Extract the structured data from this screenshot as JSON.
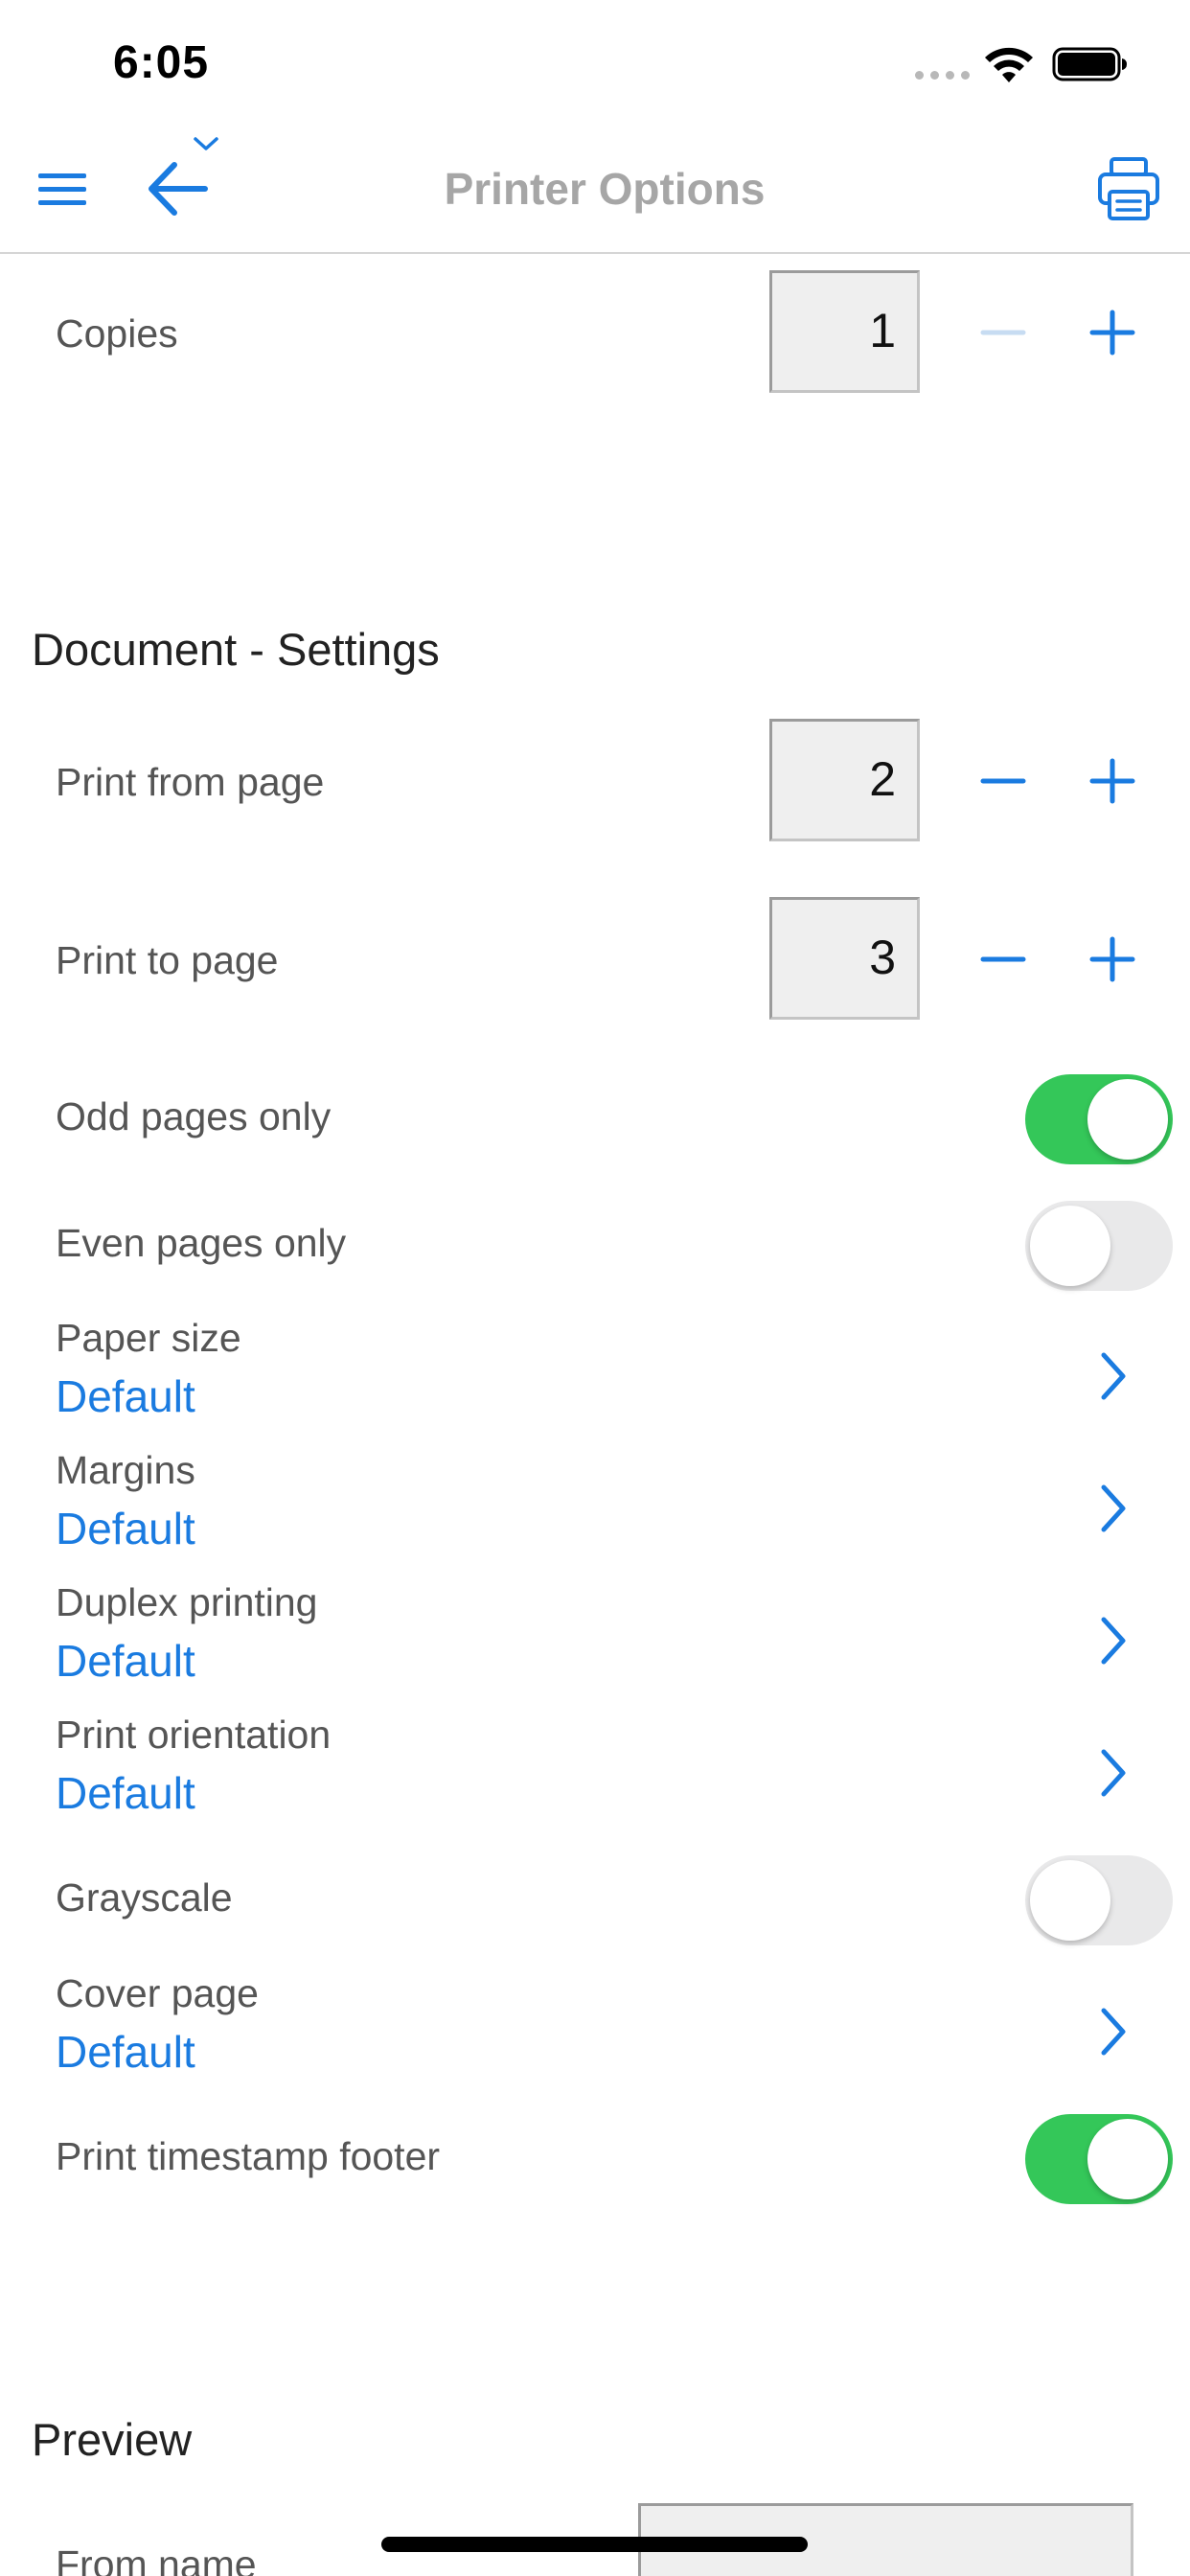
{
  "status_bar": {
    "time": "6:05"
  },
  "nav": {
    "title": "Printer Options"
  },
  "copies": {
    "label": "Copies",
    "value": "1"
  },
  "document_settings": {
    "title": "Document - Settings",
    "print_from": {
      "label": "Print from page",
      "value": "2"
    },
    "print_to": {
      "label": "Print to page",
      "value": "3"
    },
    "odd_pages": {
      "label": "Odd pages only",
      "on": true
    },
    "even_pages": {
      "label": "Even pages only",
      "on": false
    },
    "paper_size": {
      "label": "Paper size",
      "value": "Default"
    },
    "margins": {
      "label": "Margins",
      "value": "Default"
    },
    "duplex": {
      "label": "Duplex printing",
      "value": "Default"
    },
    "orientation": {
      "label": "Print orientation",
      "value": "Default"
    },
    "grayscale": {
      "label": "Grayscale",
      "on": false
    },
    "cover_page": {
      "label": "Cover page",
      "value": "Default"
    },
    "timestamp_footer": {
      "label": "Print timestamp footer",
      "on": true
    }
  },
  "preview": {
    "title": "Preview",
    "from_name": {
      "label": "From name"
    }
  },
  "colors": {
    "accent": "#1a7be0",
    "toggle_on": "#34c759",
    "toggle_off": "#e9e9ea",
    "disabled_accent": "#c7dcf2",
    "nav_title": "#a6a6a6"
  },
  "icons": {
    "menu": "menu-icon",
    "back": "back-arrow-icon",
    "printer": "printer-icon",
    "minus": "minus-icon",
    "plus": "plus-icon",
    "chevron": "chevron-right-icon"
  }
}
